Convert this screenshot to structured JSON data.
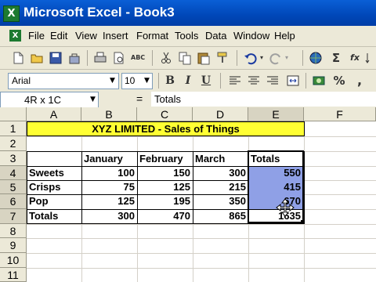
{
  "window": {
    "title": "Microsoft Excel - Book3",
    "app_icon": "X",
    "doc_icon": "X"
  },
  "menu": [
    "File",
    "Edit",
    "View",
    "Insert",
    "Format",
    "Tools",
    "Data",
    "Window",
    "Help"
  ],
  "toolbar_standard": {
    "icons": [
      "new-icon",
      "open-icon",
      "save-icon",
      "permission-icon",
      "print-icon",
      "print-preview-icon",
      "spelling-icon",
      "cut-icon",
      "copy-icon",
      "paste-icon",
      "format-painter-icon",
      "undo-icon",
      "redo-icon",
      "hyperlink-icon",
      "autosum-icon",
      "function-icon"
    ],
    "glyphs": {
      "autosum": "Σ",
      "function": "fx",
      "spelling": "ABC"
    }
  },
  "toolbar_formatting": {
    "font": "Arial",
    "size": "10",
    "bold": "B",
    "italic": "I",
    "underline": "U",
    "percent": "%",
    "comma": ","
  },
  "formula_bar": {
    "name_box": "4R x 1C",
    "equals": "=",
    "content": "Totals"
  },
  "columns": [
    "A",
    "B",
    "C",
    "D",
    "E",
    "F"
  ],
  "rows": [
    "1",
    "2",
    "3",
    "4",
    "5",
    "6",
    "7",
    "8",
    "9",
    "10",
    "11"
  ],
  "cells": {
    "A1": "XYZ LIMITED - Sales of Things",
    "B3": "January",
    "C3": "February",
    "D3": "March",
    "E3": "Totals",
    "A4": "Sweets",
    "B4": "100",
    "C4": "150",
    "D4": "300",
    "E4": "550",
    "A5": "Crisps",
    "B5": "75",
    "C5": "125",
    "D5": "215",
    "E5": "415",
    "A6": "Pop",
    "B6": "125",
    "C6": "195",
    "D6": "350",
    "E6": "670",
    "A7": "Totals",
    "B7": "300",
    "C7": "470",
    "D7": "865",
    "E7": "1635"
  },
  "colors": {
    "title_fill": "#ffff33",
    "selection_fill": "#8fa0e6",
    "titlebar": "#0047b8",
    "chrome": "#ece9d8"
  }
}
